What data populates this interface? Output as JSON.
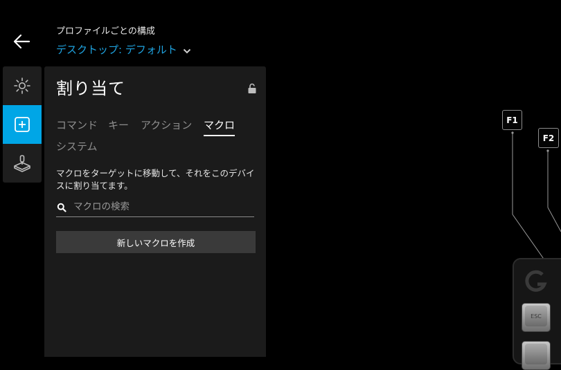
{
  "header": {
    "caption": "プロファイルごとの構成",
    "profile_name": "デスクトップ: デフォルト"
  },
  "nav": {
    "items": [
      {
        "name": "lighting",
        "icon": "sun-icon",
        "active": false
      },
      {
        "name": "assignments",
        "icon": "plus-square-icon",
        "active": true
      },
      {
        "name": "game-mode",
        "icon": "joystick-icon",
        "active": false
      }
    ]
  },
  "panel": {
    "title": "割り当て",
    "tabs": [
      {
        "label": "コマンド",
        "active": false
      },
      {
        "label": "キー",
        "active": false
      },
      {
        "label": "アクション",
        "active": false
      },
      {
        "label": "マクロ",
        "active": true
      },
      {
        "label": "システム",
        "active": false
      }
    ],
    "description": "マクロをターゲットに移動して、それをこのデバイスに割り当てます。",
    "search_placeholder": "マクロの検索",
    "new_macro_label": "新しいマクロを作成"
  },
  "keyboard": {
    "fkeys": [
      "F1",
      "F2"
    ],
    "esc_label": "ESC"
  },
  "colors": {
    "accent": "#00a6e6",
    "profile_link": "#1fa3e0",
    "panel_bg": "#1b1b1b"
  }
}
